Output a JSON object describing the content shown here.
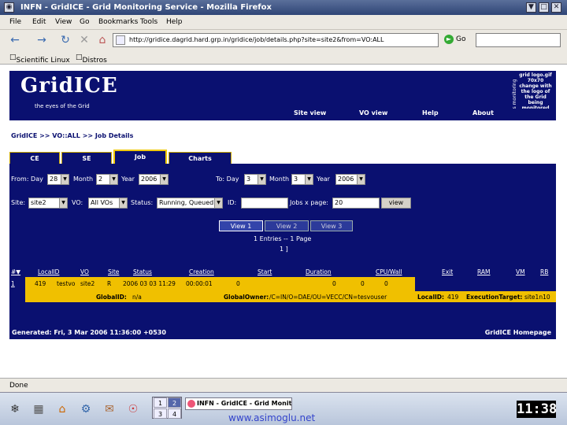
{
  "window": {
    "title": "INFN - GridICE - Grid Monitoring Service - Mozilla Firefox",
    "controls": [
      "▼",
      "□",
      "✕"
    ]
  },
  "menu": [
    "File",
    "Edit",
    "View",
    "Go",
    "Bookmarks",
    "Tools",
    "Help"
  ],
  "toolbar": {
    "back_icon": "←",
    "forward_icon": "→",
    "reload_icon": "↻",
    "stop_icon": "✕",
    "home_icon": "⌂",
    "url": "http://gridice.dagrid.hard.grp.in/gridice/job/details.php?site=site2&from=VO:ALL",
    "go_label": "Go"
  },
  "bookmarks": [
    "Scientific Linux",
    "Distros"
  ],
  "banner": {
    "logo": "GridICE",
    "tagline": "the eyes of the Grid",
    "logo_placeholder": "grid logo.gif 70x70 change with the logo of the Grid being monitored",
    "vertical_text": "is monitoring"
  },
  "topnav": [
    "Site view",
    "VO view",
    "Help",
    "About"
  ],
  "breadcrumb": "GridICE >> VO::ALL >> Job Details",
  "tabs": [
    "CE",
    "SE",
    "Job",
    "Charts"
  ],
  "form": {
    "from_label": "From: Day",
    "from_day": "28",
    "month_label": "Month",
    "from_month": "2",
    "year_label": "Year",
    "from_year": "2006",
    "to_label": "To: Day",
    "to_day": "3",
    "to_month": "3",
    "to_year": "2006",
    "site_label": "Site:",
    "site_value": "site2",
    "vo_label": "VO:",
    "vo_value": "All VOs",
    "status_label": "Status:",
    "status_value": "Running, Queued",
    "id_label": "ID:",
    "id_value": "",
    "jobs_label": "Jobs x page:",
    "jobs_value": "20",
    "view_button": "view"
  },
  "view_tabs": [
    "View 1",
    "View 2",
    "View 3"
  ],
  "entries_text": "1 Entries -- 1 Page",
  "page_num": "1 ]",
  "table": {
    "columns": [
      "#▼",
      "LocalID",
      "VO",
      "Site",
      "Status",
      "Creation",
      "Start",
      "Duration",
      "CPU/Wall",
      "Exit",
      "RAM",
      "VM",
      "RB"
    ],
    "row": {
      "num": "1",
      "localid": "419",
      "vo": "testvo",
      "site": "site2",
      "status": "R",
      "creation": "2006 03 03 11:29",
      "duration_short": "00:00:01",
      "start": "0",
      "duration": "0",
      "cpu": "0",
      "wall": "0"
    },
    "detail": {
      "globalid_label": "GlobalID:",
      "globalid_value": "n/a",
      "owner_label": "GlobalOwner:",
      "owner_value": "/C=IN/O=DAE/OU=VECC/CN=tesvouser",
      "localid_label": "LocalID:",
      "localid_value": "419",
      "target_label": "ExecutionTarget:",
      "target_value": "site1n10"
    }
  },
  "footer": {
    "generated": "Generated: Fri, 3 Mar 2006 11:36:00 +0530",
    "homepage": "GridICE Homepage"
  },
  "status": "Done",
  "taskbar": {
    "pager": [
      "1",
      "2",
      "3",
      "4"
    ],
    "task_label": "INFN - GridICE - Grid Monit",
    "clock": "11:38"
  },
  "overlay_url": "www.asimoglu.net"
}
